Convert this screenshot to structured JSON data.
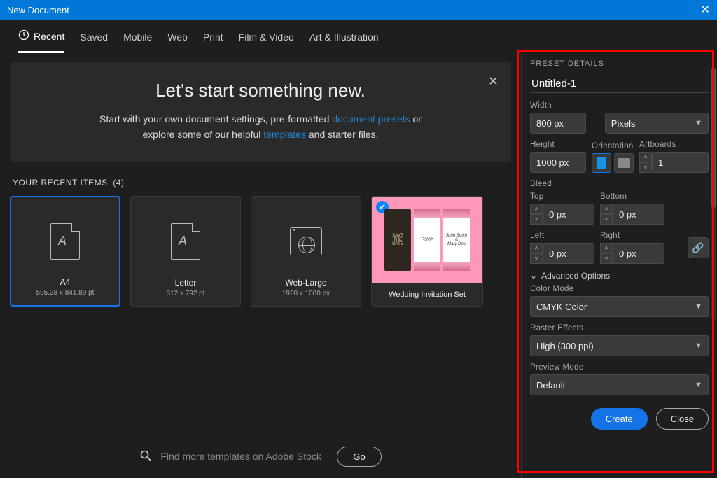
{
  "window": {
    "title": "New Document"
  },
  "tabs": {
    "items": [
      {
        "label": "Recent"
      },
      {
        "label": "Saved"
      },
      {
        "label": "Mobile"
      },
      {
        "label": "Web"
      },
      {
        "label": "Print"
      },
      {
        "label": "Film & Video"
      },
      {
        "label": "Art & Illustration"
      }
    ]
  },
  "hero": {
    "heading": "Let's start something new.",
    "line1_pre": "Start with your own document settings, pre-formatted ",
    "link1": "document presets",
    "line1_post": " or",
    "line2_pre": "explore some of our helpful ",
    "link2": "templates",
    "line2_post": " and starter files."
  },
  "section": {
    "label": "YOUR RECENT ITEMS",
    "count": "(4)"
  },
  "cards": [
    {
      "name": "a4",
      "title": "A4",
      "subtitle": "595.28 x 841.89 pt"
    },
    {
      "name": "letter",
      "title": "Letter",
      "subtitle": "612 x 792 pt"
    },
    {
      "name": "web-large",
      "title": "Web-Large",
      "subtitle": "1920 x 1080 px"
    },
    {
      "name": "template",
      "title": "Wedding Invitation Set",
      "subtitle": ""
    }
  ],
  "template_card": {
    "dark_line1": "SAVE",
    "dark_line2": "DATE",
    "mid_rsvp": "RSVP",
    "right_name1": "John Smith",
    "right_amp": "&",
    "right_name2": "Mary Doe"
  },
  "search": {
    "placeholder": "Find more templates on Adobe Stock",
    "button": "Go"
  },
  "preset": {
    "header": "PRESET DETAILS",
    "name": "Untitled-1",
    "width_label": "Width",
    "width_value": "800 px",
    "units": "Pixels",
    "height_label": "Height",
    "height_value": "1000 px",
    "orientation_label": "Orientation",
    "artboards_label": "Artboards",
    "artboards_value": "1",
    "bleed_label": "Bleed",
    "top_label": "Top",
    "top_value": "0 px",
    "bottom_label": "Bottom",
    "bottom_value": "0 px",
    "left_label": "Left",
    "left_value": "0 px",
    "right_label": "Right",
    "right_value": "0 px",
    "advanced_label": "Advanced Options",
    "colormode_label": "Color Mode",
    "colormode_value": "CMYK Color",
    "raster_label": "Raster Effects",
    "raster_value": "High (300 ppi)",
    "preview_label": "Preview Mode",
    "preview_value": "Default",
    "create": "Create",
    "close": "Close"
  }
}
